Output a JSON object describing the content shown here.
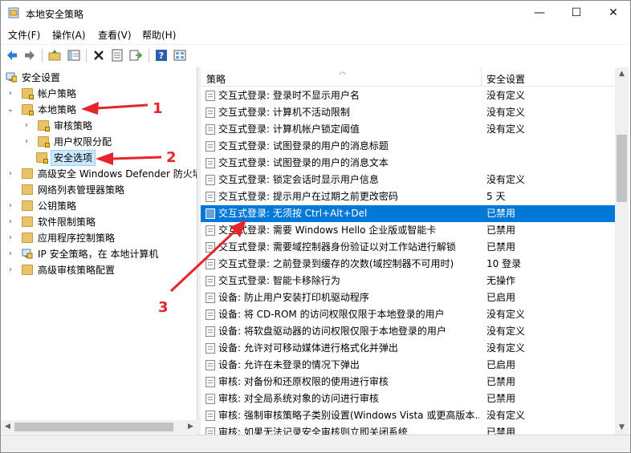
{
  "window": {
    "title": "本地安全策略",
    "minimize_glyph": "—",
    "maximize_glyph": "☐",
    "close_glyph": "✕"
  },
  "menu": [
    "文件(F)",
    "操作(A)",
    "查看(V)",
    "帮助(H)"
  ],
  "toolbar_icons": [
    "back-icon",
    "forward-icon",
    "up-folder-icon",
    "show-tree-icon",
    "delete-icon",
    "properties-icon",
    "export-icon",
    "help-icon",
    "view-icon"
  ],
  "tree": [
    {
      "label": "安全设置",
      "expander": "",
      "icon": "shield-computer-icon"
    },
    {
      "label": "帐户策略",
      "expander": "›",
      "icon": "policy-folder-icon"
    },
    {
      "label": "本地策略",
      "expander": "⌄",
      "icon": "policy-folder-icon"
    },
    {
      "label": "审核策略",
      "expander": "›",
      "icon": "policy-folder-icon"
    },
    {
      "label": "用户权限分配",
      "expander": "›",
      "icon": "policy-folder-icon"
    },
    {
      "label": "安全选项",
      "expander": "",
      "icon": "policy-folder-icon",
      "selected": true
    },
    {
      "label": "高级安全 Windows Defender 防火墙",
      "expander": "›",
      "icon": "folder-icon"
    },
    {
      "label": "网络列表管理器策略",
      "expander": "",
      "icon": "folder-icon"
    },
    {
      "label": "公钥策略",
      "expander": "›",
      "icon": "folder-icon"
    },
    {
      "label": "软件限制策略",
      "expander": "›",
      "icon": "folder-icon"
    },
    {
      "label": "应用程序控制策略",
      "expander": "›",
      "icon": "folder-icon"
    },
    {
      "label": "IP 安全策略，在 本地计算机",
      "expander": "›",
      "icon": "ip-security-icon"
    },
    {
      "label": "高级审核策略配置",
      "expander": "›",
      "icon": "folder-icon"
    }
  ],
  "list": {
    "col_policy": "策略",
    "col_setting": "安全设置",
    "rows": [
      {
        "policy": "交互式登录: 登录时不显示用户名",
        "setting": "没有定义"
      },
      {
        "policy": "交互式登录: 计算机不活动限制",
        "setting": "没有定义"
      },
      {
        "policy": "交互式登录: 计算机帐户锁定阈值",
        "setting": "没有定义"
      },
      {
        "policy": "交互式登录: 试图登录的用户的消息标题",
        "setting": ""
      },
      {
        "policy": "交互式登录: 试图登录的用户的消息文本",
        "setting": ""
      },
      {
        "policy": "交互式登录: 锁定会话时显示用户信息",
        "setting": "没有定义"
      },
      {
        "policy": "交互式登录: 提示用户在过期之前更改密码",
        "setting": "5 天"
      },
      {
        "policy": "交互式登录: 无须按 Ctrl+Alt+Del",
        "setting": "已禁用",
        "selected": true
      },
      {
        "policy": "交互式登录: 需要 Windows Hello 企业版或智能卡",
        "setting": "已禁用"
      },
      {
        "policy": "交互式登录: 需要域控制器身份验证以对工作站进行解锁",
        "setting": "已禁用"
      },
      {
        "policy": "交互式登录: 之前登录到缓存的次数(域控制器不可用时)",
        "setting": "10 登录"
      },
      {
        "policy": "交互式登录: 智能卡移除行为",
        "setting": "无操作"
      },
      {
        "policy": "设备: 防止用户安装打印机驱动程序",
        "setting": "已启用"
      },
      {
        "policy": "设备: 将 CD-ROM 的访问权限仅限于本地登录的用户",
        "setting": "没有定义"
      },
      {
        "policy": "设备: 将软盘驱动器的访问权限仅限于本地登录的用户",
        "setting": "没有定义"
      },
      {
        "policy": "设备: 允许对可移动媒体进行格式化并弹出",
        "setting": "没有定义"
      },
      {
        "policy": "设备: 允许在未登录的情况下弹出",
        "setting": "已启用"
      },
      {
        "policy": "审核: 对备份和还原权限的使用进行审核",
        "setting": "已禁用"
      },
      {
        "policy": "审核: 对全局系统对象的访问进行审核",
        "setting": "已禁用"
      },
      {
        "policy": "审核: 强制审核策略子类别设置(Windows Vista 或更高版本...",
        "setting": "没有定义"
      },
      {
        "policy": "审核: 如果无法记录安全审核则立即关闭系统",
        "setting": "已禁用"
      }
    ]
  },
  "annotations": [
    "1",
    "2",
    "3"
  ],
  "colors": {
    "selection": "#0078d7",
    "annotation": "#e8242b"
  }
}
